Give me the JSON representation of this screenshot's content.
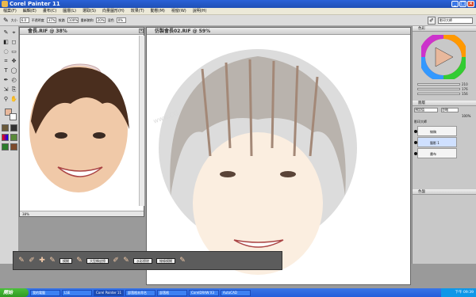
{
  "window": {
    "title": "Corel Painter 11"
  },
  "menu": [
    "檔案(F)",
    "編輯(E)",
    "畫布(C)",
    "圖層(L)",
    "選取(S)",
    "向量圖形(H)",
    "效果(T)",
    "動態(M)",
    "視窗(W)",
    "說明(H)"
  ],
  "propbar": {
    "size_label": "大小",
    "size_value": "6.0",
    "opacity_label": "不透明度",
    "opacity_value": "37%",
    "grain_label": "紋路",
    "grain_value": "100%",
    "resat_label": "重新飽和",
    "resat_value": "20%",
    "bleed_label": "混色",
    "bleed_value": "0%",
    "right_tool": "影印大師"
  },
  "documents": {
    "reference": {
      "title": "會長.RIF @ 38%",
      "zoom": "38%"
    },
    "main": {
      "title": "仿製會長02.RIF @ 59%",
      "watermark": "www.CG-Lovers.com"
    }
  },
  "panels": {
    "colors": {
      "title": "色彩",
      "r_label": "R",
      "r": "210",
      "g_label": "G",
      "g": "176",
      "b_label": "B",
      "b": "156"
    },
    "layers": {
      "title": "圖層",
      "composite": "預設值",
      "method": "忽略",
      "opacity": "100%",
      "items": [
        "影印大師",
        "線稿",
        "腦影 1",
        "畫布"
      ]
    },
    "mixer": {
      "title": "色盤"
    }
  },
  "brushbar": {
    "buttons": [
      "模糊",
      "大型橡皮擦",
      "水彩擦除",
      "線條模糊"
    ]
  },
  "taskbar": {
    "start": "開始",
    "tasks": [
      "我的電腦",
      "LSE",
      "Corel Painter 11",
      "部落格未命名",
      "部落格",
      "CorelDRAW X3",
      "AutoCAD"
    ],
    "active_index": 2,
    "clock": "下午 09:39"
  },
  "colors": {
    "accent": "#245edb",
    "current_color": "#e8b89c",
    "title_blue": "#2a62d8"
  }
}
